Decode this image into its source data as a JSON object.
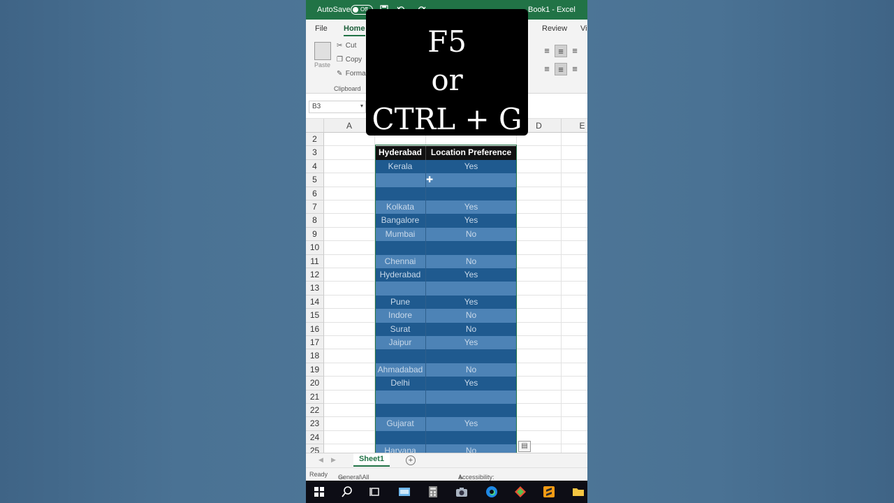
{
  "titlebar": {
    "autosave_label": "AutoSave",
    "toggle_state": "Off",
    "doc_title": "Book1  -  Excel"
  },
  "ribbon_tabs": {
    "file": "File",
    "home": "Home",
    "review": "Review",
    "view_partial": "Vi"
  },
  "ribbon": {
    "paste": "Paste",
    "cut": "Cut",
    "copy": "Copy",
    "format": "Forma",
    "clipboard": "Clipboard"
  },
  "namebox": {
    "value": "B3"
  },
  "columns": {
    "a": "A",
    "d": "D",
    "e": "E"
  },
  "table": {
    "headers": [
      "Hyderabad",
      "Location Preference"
    ],
    "rows": [
      {
        "row": "4",
        "city": "Kerala",
        "pref": "Yes"
      },
      {
        "row": "5",
        "city": "",
        "pref": ""
      },
      {
        "row": "6",
        "city": "",
        "pref": ""
      },
      {
        "row": "7",
        "city": "Kolkata",
        "pref": "Yes"
      },
      {
        "row": "8",
        "city": "Bangalore",
        "pref": "Yes"
      },
      {
        "row": "9",
        "city": "Mumbai",
        "pref": "No"
      },
      {
        "row": "10",
        "city": "",
        "pref": ""
      },
      {
        "row": "11",
        "city": "Chennai",
        "pref": "No"
      },
      {
        "row": "12",
        "city": "Hyderabad",
        "pref": "Yes"
      },
      {
        "row": "13",
        "city": "",
        "pref": ""
      },
      {
        "row": "14",
        "city": "Pune",
        "pref": "Yes"
      },
      {
        "row": "15",
        "city": "Indore",
        "pref": "No"
      },
      {
        "row": "16",
        "city": "Surat",
        "pref": "No"
      },
      {
        "row": "17",
        "city": "Jaipur",
        "pref": "Yes"
      },
      {
        "row": "18",
        "city": "",
        "pref": ""
      },
      {
        "row": "19",
        "city": "Ahmadabad",
        "pref": "No"
      },
      {
        "row": "20",
        "city": "Delhi",
        "pref": "Yes"
      },
      {
        "row": "21",
        "city": "",
        "pref": ""
      },
      {
        "row": "22",
        "city": "",
        "pref": ""
      },
      {
        "row": "23",
        "city": "Gujarat",
        "pref": "Yes"
      },
      {
        "row": "24",
        "city": "",
        "pref": ""
      },
      {
        "row": "25",
        "city": "Haryana",
        "pref": "No"
      }
    ]
  },
  "row_labels_top": [
    "2",
    "3"
  ],
  "sheet": {
    "tab": "Sheet1",
    "add": "+"
  },
  "statusbar": {
    "ready": "Ready",
    "sensitivity": "General\\All Employees (unrestricted)",
    "accessibility": "Accessibility: Investigate"
  },
  "overlay": {
    "line1": "F5",
    "line2": "or",
    "line3": "CTRL + G"
  },
  "colors": {
    "excel_green": "#217346",
    "band_dark": "#1f5a8f",
    "band_light": "#4d83b6",
    "header_black": "#111111"
  }
}
